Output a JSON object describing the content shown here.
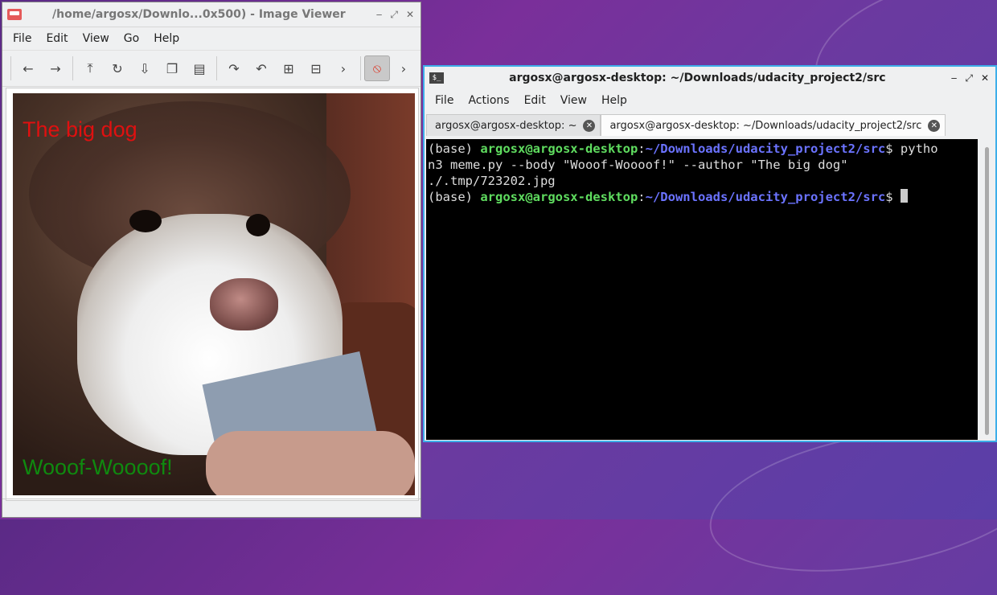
{
  "viewer": {
    "title": "/home/argosx/Downlo...0x500) - Image Viewer",
    "menu": [
      "File",
      "Edit",
      "View",
      "Go",
      "Help"
    ],
    "toolbar_icons": [
      "back-icon",
      "forward-icon",
      "upload-icon",
      "reload-icon",
      "save-icon",
      "copy-icon",
      "paste-icon",
      "rotate-cw-icon",
      "rotate-ccw-icon",
      "zoom-in-icon",
      "zoom-out-icon",
      "next-icon",
      "stop-icon",
      "more-icon"
    ],
    "meme_top": "The big dog",
    "meme_bottom": "Wooof-Woooof!"
  },
  "terminal": {
    "title": "argosx@argosx-desktop: ~/Downloads/udacity_project2/src",
    "menu": [
      "File",
      "Actions",
      "Edit",
      "View",
      "Help"
    ],
    "tabs": [
      {
        "label": "argosx@argosx-desktop: ~"
      },
      {
        "label": "argosx@argosx-desktop: ~/Downloads/udacity_project2/src"
      }
    ],
    "lines": {
      "l1_prefix": "(base) ",
      "l1_user": "argosx@argosx-desktop",
      "l1_colon": ":",
      "l1_path": "~/Downloads/udacity_project2/src",
      "l1_cmd": "$ pytho",
      "l2": "n3 meme.py --body \"Wooof-Woooof!\" --author \"The big dog\"",
      "l3": "./.tmp/723202.jpg",
      "l4_prefix": "(base) ",
      "l4_user": "argosx@argosx-desktop",
      "l4_colon": ":",
      "l4_path": "~/Downloads/udacity_project2/src",
      "l4_cmd": "$ "
    }
  },
  "colors": {
    "accent": "#3daee9",
    "prompt_user": "#5fdc5f",
    "prompt_path": "#6b73ff",
    "meme_top": "#e01010",
    "meme_bottom": "#0f8a0f"
  }
}
